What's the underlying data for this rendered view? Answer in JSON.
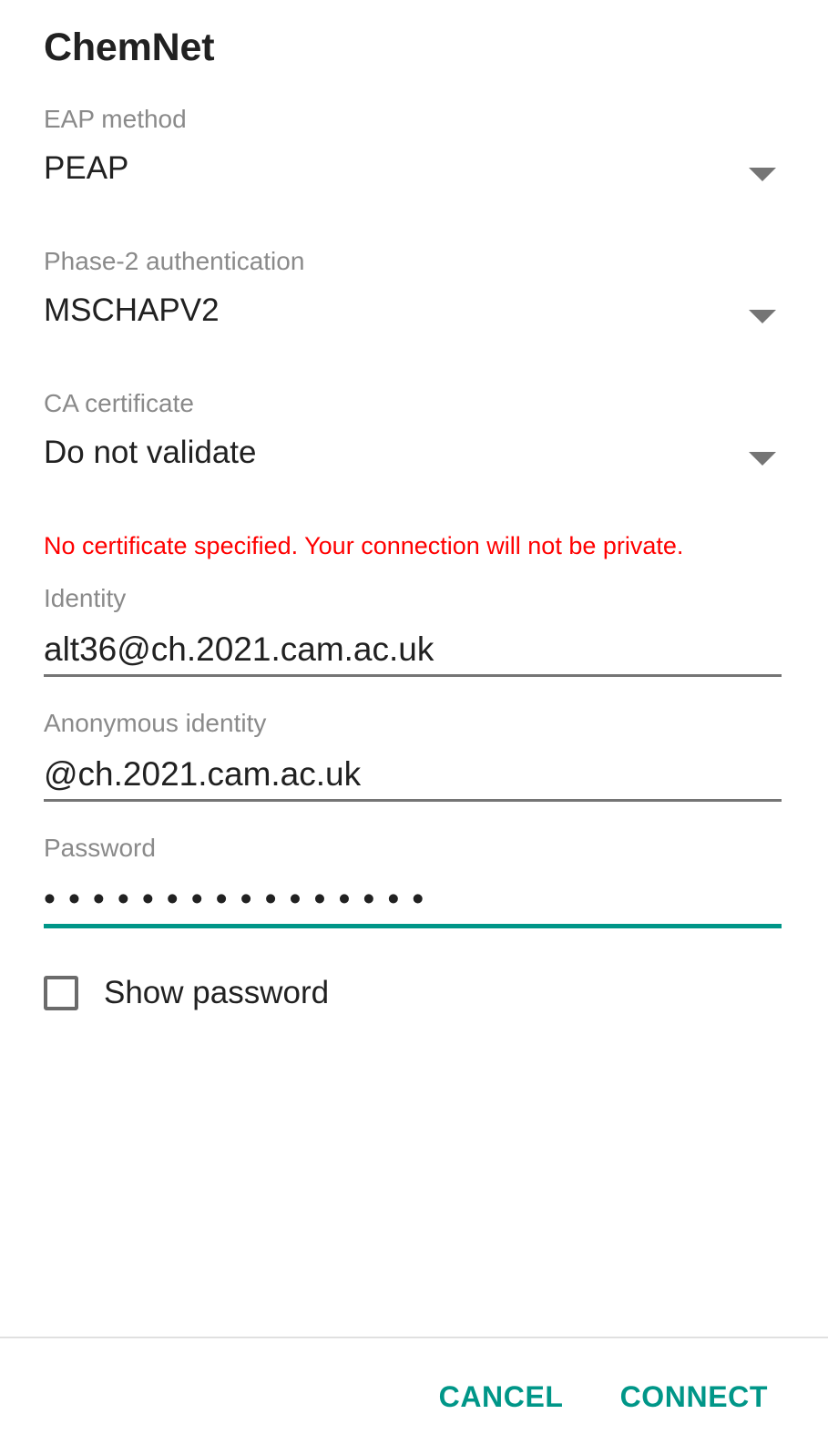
{
  "dialog": {
    "title": "ChemNet"
  },
  "fields": {
    "eap_method": {
      "label": "EAP method",
      "value": "PEAP",
      "arrow_icon": "chevron-down-icon"
    },
    "phase2": {
      "label": "Phase-2 authentication",
      "value": "MSCHAPV2",
      "arrow_icon": "chevron-down-icon"
    },
    "ca_certificate": {
      "label": "CA certificate",
      "value": "Do not validate",
      "arrow_icon": "chevron-down-icon"
    },
    "warning": {
      "text": "No certificate specified. Your connection will not be private.",
      "color": "#ff0000"
    },
    "identity": {
      "label": "Identity",
      "value": "alt36@ch.2021.cam.ac.uk",
      "placeholder": ""
    },
    "anonymous_identity": {
      "label": "Anonymous identity",
      "value": "@ch.2021.cam.ac.uk",
      "placeholder": ""
    },
    "password": {
      "label": "Password",
      "masked_value": "••••••••••••••••",
      "char_count": 16,
      "placeholder": "",
      "focused": true,
      "underline_color": "#009688"
    },
    "show_password": {
      "label": "Show password",
      "checked": false
    }
  },
  "buttons": {
    "cancel": "CANCEL",
    "connect": "CONNECT"
  },
  "colors": {
    "accent": "#009688",
    "label_gray": "#8a8a8a",
    "text_dark": "#212121",
    "underline_gray": "#757575",
    "divider": "#e0e0e0",
    "error_red": "#ff0000"
  }
}
